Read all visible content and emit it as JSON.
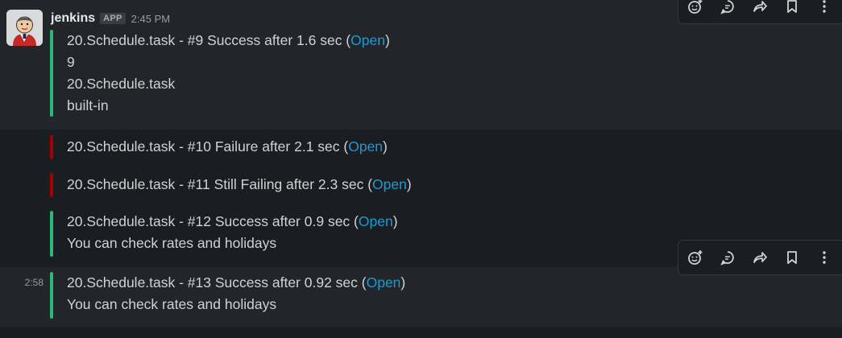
{
  "message": {
    "author": "jenkins",
    "badge": "APP",
    "time": "2:45 PM"
  },
  "attachments": [
    {
      "status_color": "green",
      "title": "20.Schedule.task - #9 Success after 1.6 sec (",
      "link": "Open",
      "close": ")",
      "fields": [
        "9",
        "20.Schedule.task",
        "built-in"
      ]
    },
    {
      "status_color": "red",
      "title": "20.Schedule.task - #10 Failure after 2.1 sec (",
      "link": "Open",
      "close": ")"
    },
    {
      "status_color": "red",
      "title": "20.Schedule.task - #11 Still Failing after 2.3 sec (",
      "link": "Open",
      "close": ")"
    },
    {
      "status_color": "green",
      "title": "20.Schedule.task - #12 Success after 0.9 sec (",
      "link": "Open",
      "close": ")",
      "fields": [
        "You can check rates and holidays"
      ]
    },
    {
      "status_color": "green",
      "side_time": "2:58",
      "title": "20.Schedule.task - #13 Success after 0.92 sec (",
      "link": "Open",
      "close": ")",
      "fields": [
        "You can check rates and holidays"
      ]
    }
  ],
  "toolbar_icons": [
    "add-reaction-icon",
    "reply-in-thread-icon",
    "share-icon",
    "bookmark-icon",
    "more-actions-icon"
  ],
  "colors": {
    "background": "#1a1d21",
    "hover_background": "#222529",
    "success": "#2eb67d",
    "failure": "#a30200",
    "link": "#1d9bd1"
  }
}
